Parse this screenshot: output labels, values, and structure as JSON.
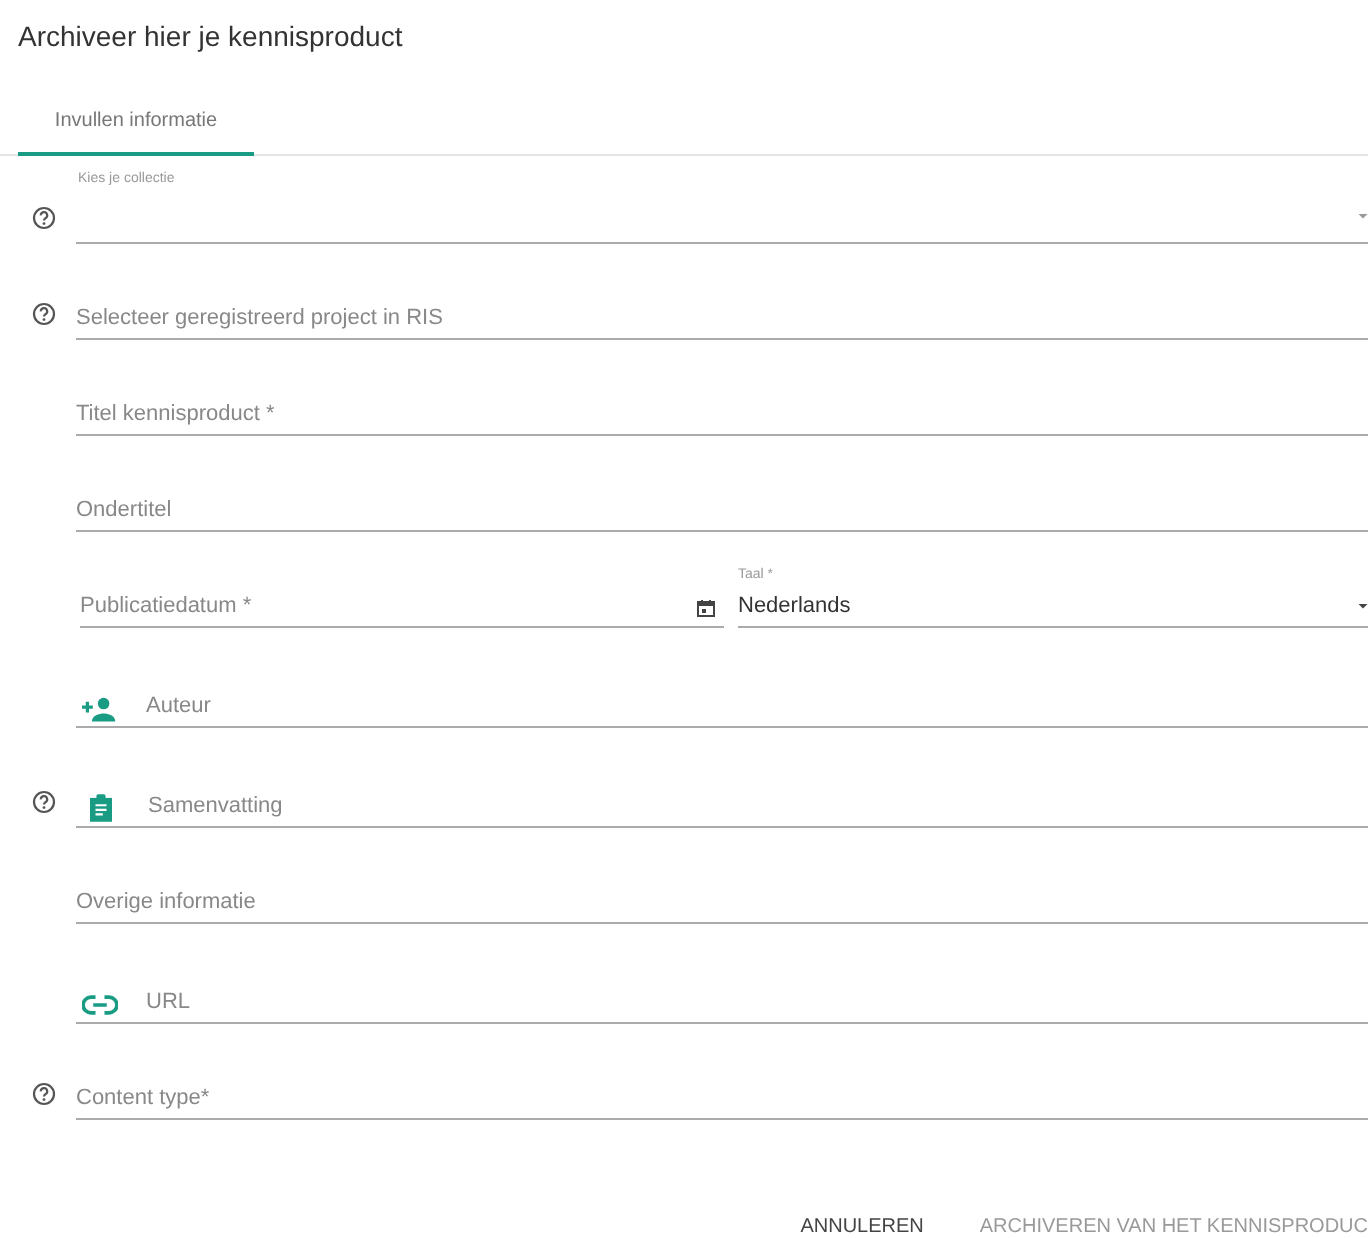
{
  "title": "Archiveer hier je kennisproduct",
  "tabs": [
    {
      "label": "Invullen informatie",
      "selected": true
    }
  ],
  "fields": [
    {
      "kind": "select",
      "help": true,
      "label": "Kies je collectie"
    },
    {
      "kind": "text",
      "help": true,
      "placeholder": "Selecteer geregistreerd project in RIS"
    },
    {
      "kind": "text",
      "help": false,
      "placeholder": "Titel kennisproduct *"
    },
    {
      "kind": "text",
      "help": false,
      "placeholder": "Ondertitel"
    },
    {
      "kind": "date-language",
      "help": false,
      "placeholder": "Publicatiedatum *",
      "label": "Taal *",
      "value": "Nederlands"
    },
    {
      "kind": "person",
      "help": false,
      "placeholder": "Auteur"
    },
    {
      "kind": "summary",
      "help": true,
      "placeholder": "Samenvatting"
    },
    {
      "kind": "text",
      "help": false,
      "placeholder": "Overige informatie"
    },
    {
      "kind": "link",
      "help": false,
      "placeholder": "URL"
    },
    {
      "kind": "text",
      "help": true,
      "placeholder": "Content type*"
    }
  ],
  "buttons": [
    {
      "label": "ANNULEREN",
      "primary": false
    },
    {
      "label": "ARCHIVEREN VAN HET KENNISPRODUC",
      "primary": true
    }
  ]
}
